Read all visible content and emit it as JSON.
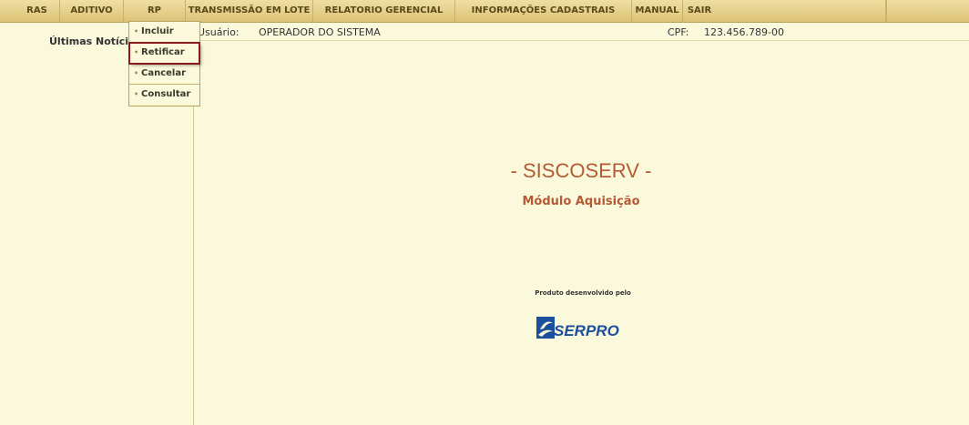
{
  "menu": {
    "items": [
      "RAS",
      "ADITIVO",
      "RP",
      "TRANSMISSÃO EM LOTE",
      "RELATORIO GERENCIAL",
      "INFORMAÇÕES CADASTRAIS",
      "MANUAL",
      "SAIR"
    ]
  },
  "dropdown": {
    "items": [
      "Incluir",
      "Retificar",
      "Cancelar",
      "Consultar"
    ],
    "highlighted": "Retificar"
  },
  "sidebar": {
    "title": "Últimas Notícias"
  },
  "user": {
    "user_label": "Usuário:",
    "user_value": "OPERADOR DO SISTEMA",
    "cpf_label": "CPF:",
    "cpf_value": "123.456.789-00"
  },
  "main": {
    "app_title": "- SISCOSERV -",
    "module": "Módulo Aquisição",
    "product_note": "Produto desenvolvido pelo",
    "logo_text": "SERPRO"
  },
  "colors": {
    "accent": "#b55a35",
    "logo_blue": "#1b4f9c",
    "menu_bg": "#e4cd85",
    "page_bg": "#fbf9dc"
  }
}
